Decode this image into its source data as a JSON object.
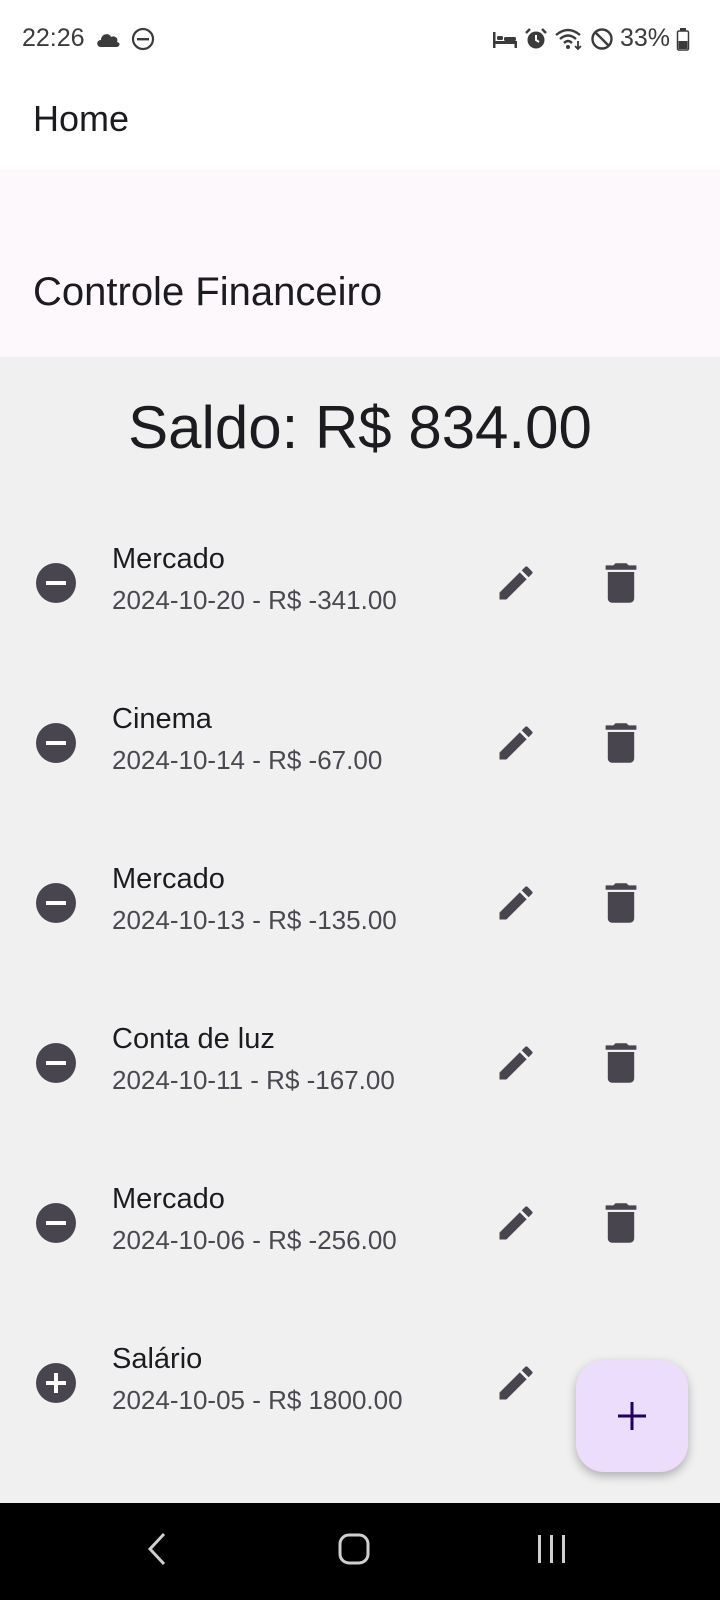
{
  "status_bar": {
    "time": "22:26",
    "battery": "33%",
    "icons_left": [
      "cloud-icon",
      "do-not-disturb-icon"
    ],
    "icons_right": [
      "bed-icon",
      "alarm-icon",
      "wifi-icon",
      "blocked-icon",
      "battery-icon"
    ]
  },
  "app_bar": {
    "title": "Home"
  },
  "header": {
    "title": "Controle Financeiro"
  },
  "balance": {
    "text": "Saldo: R$ 834.00"
  },
  "transactions": [
    {
      "title": "Mercado",
      "subtitle": "2024-10-20 - R$ -341.00",
      "type": "expense",
      "icon": "minus-circle-icon"
    },
    {
      "title": "Cinema",
      "subtitle": "2024-10-14 - R$ -67.00",
      "type": "expense",
      "icon": "minus-circle-icon"
    },
    {
      "title": "Mercado",
      "subtitle": "2024-10-13 - R$ -135.00",
      "type": "expense",
      "icon": "minus-circle-icon"
    },
    {
      "title": "Conta de luz",
      "subtitle": "2024-10-11 - R$ -167.00",
      "type": "expense",
      "icon": "minus-circle-icon"
    },
    {
      "title": "Mercado",
      "subtitle": "2024-10-06 - R$ -256.00",
      "type": "expense",
      "icon": "minus-circle-icon"
    },
    {
      "title": "Salário",
      "subtitle": "2024-10-05 - R$ 1800.00",
      "type": "income",
      "icon": "plus-circle-icon"
    }
  ],
  "row_actions": {
    "edit_icon": "pencil-icon",
    "delete_icon": "trash-icon"
  },
  "fab": {
    "icon": "plus-icon"
  },
  "nav_bar": {
    "buttons": [
      "back-icon",
      "home-icon",
      "recents-icon"
    ]
  },
  "colors": {
    "icon_dark": "#49454f",
    "fab_bg": "#ebddfb",
    "fab_icon": "#21005d",
    "header_bg": "#fcf8fc",
    "content_bg": "#f1f0f1"
  }
}
